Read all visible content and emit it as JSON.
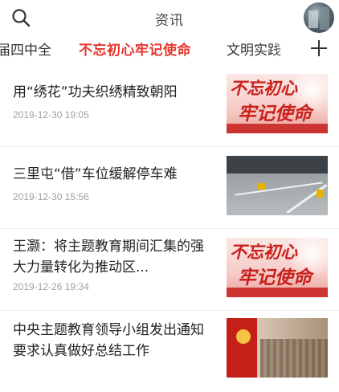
{
  "header": {
    "title": "资讯",
    "search_icon": "search-icon",
    "avatar_icon": "avatar"
  },
  "tabs": {
    "left_partial": "届四中全",
    "active": "不忘初心牢记使命",
    "right_partial": "文明实践",
    "add_icon": "plus-icon"
  },
  "colors": {
    "accent": "#e8352e",
    "date": "#a0a0a0",
    "text": "#222222"
  },
  "articles": [
    {
      "title": "用“绣花”功夫织绣精致朝阳",
      "date": "2019-12-30 19:05",
      "thumb_text_1": "不忘初心",
      "thumb_text_2": "牢记使命"
    },
    {
      "title": "三里屯“借”车位缓解停车难",
      "date": "2019-12-30 15:56"
    },
    {
      "title": "王灏：将主题教育期间汇集的强大力量转化为推动区...",
      "date": "2019-12-26 19:34",
      "thumb_text_1": "不忘初心",
      "thumb_text_2": "牢记使命"
    },
    {
      "title": "中央主题教育领导小组发出通知 要求认真做好总结工作",
      "date": ""
    }
  ]
}
